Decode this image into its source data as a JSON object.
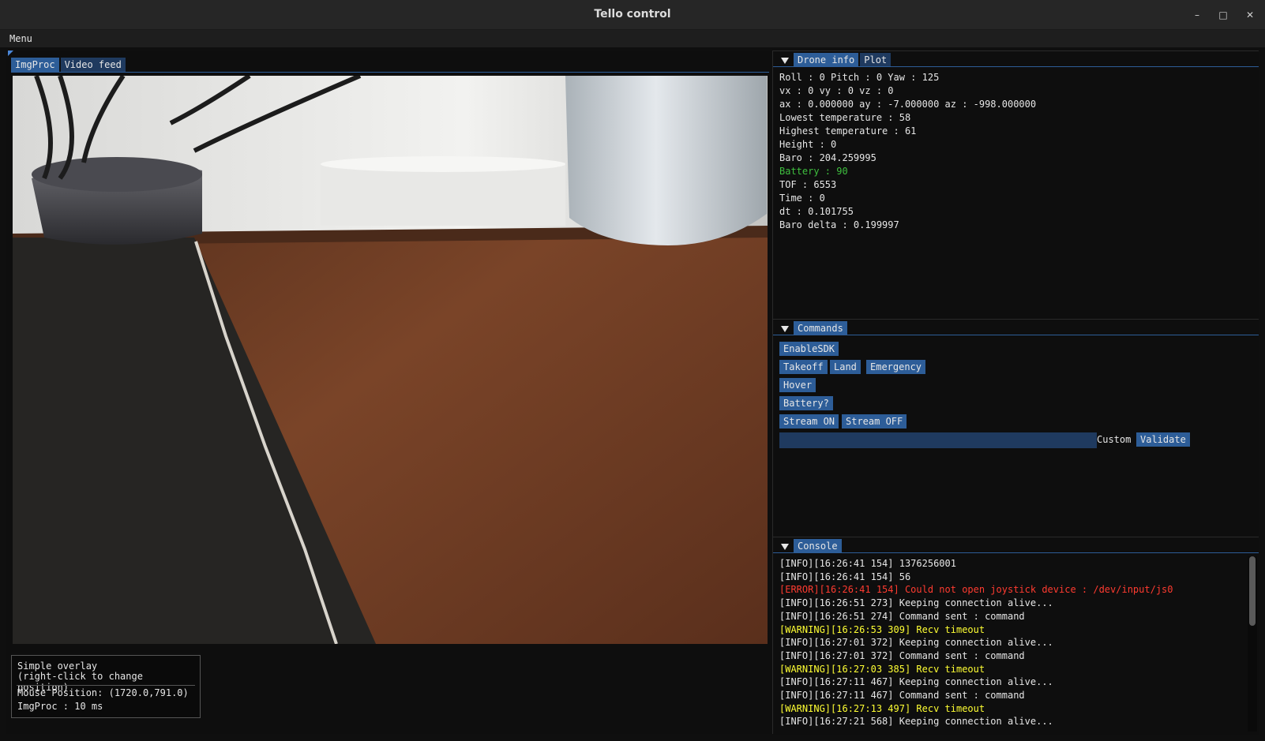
{
  "window": {
    "title": "Tello control",
    "minimize": "–",
    "maximize": "□",
    "close": "✕"
  },
  "menubar": {
    "menu": "Menu"
  },
  "left_tabs": [
    {
      "label": "ImgProc",
      "active": true
    },
    {
      "label": "Video feed",
      "active": false
    }
  ],
  "overlay": {
    "line1": "Simple overlay",
    "line2": "(right-click to change position)",
    "mouse": "Mouse Position: (1720.0,791.0)",
    "imgproc": "ImgProc :  10 ms"
  },
  "drone_panel": {
    "tabs": [
      {
        "label": "Drone info",
        "active": true
      },
      {
        "label": "Plot",
        "active": false
      }
    ],
    "lines": [
      "Roll : 0 Pitch : 0 Yaw : 125",
      "vx : 0 vy : 0 vz : 0",
      "ax : 0.000000 ay : -7.000000 az : -998.000000",
      "Lowest temperature : 58",
      "Highest temperature : 61",
      "Height : 0",
      "Baro : 204.259995",
      "Battery : 90",
      "TOF : 6553",
      "Time : 0",
      "dt : 0.101755",
      "Baro delta : 0.199997"
    ],
    "battery_color": "#3fbf3f"
  },
  "commands_panel": {
    "title": "Commands",
    "enable_sdk": "EnableSDK",
    "takeoff": "Takeoff",
    "land": "Land",
    "emergency": "Emergency",
    "hover": "Hover",
    "battery": "Battery?",
    "stream_on": "Stream ON",
    "stream_off": "Stream OFF",
    "custom_label": "Custom",
    "custom_value": "",
    "validate": "Validate"
  },
  "console_panel": {
    "title": "Console",
    "log": [
      {
        "level": "info",
        "text": "[INFO][16:26:41 154] 1376256001"
      },
      {
        "level": "info",
        "text": "[INFO][16:26:41 154] 56"
      },
      {
        "level": "error",
        "text": "[ERROR][16:26:41 154] Could not open joystick device : /dev/input/js0"
      },
      {
        "level": "info",
        "text": "[INFO][16:26:51 273] Keeping connection alive..."
      },
      {
        "level": "info",
        "text": "[INFO][16:26:51 274] Command sent : command"
      },
      {
        "level": "warning",
        "text": "[WARNING][16:26:53 309] Recv timeout"
      },
      {
        "level": "info",
        "text": "[INFO][16:27:01 372] Keeping connection alive..."
      },
      {
        "level": "info",
        "text": "[INFO][16:27:01 372] Command sent : command"
      },
      {
        "level": "warning",
        "text": "[WARNING][16:27:03 385] Recv timeout"
      },
      {
        "level": "info",
        "text": "[INFO][16:27:11 467] Keeping connection alive..."
      },
      {
        "level": "info",
        "text": "[INFO][16:27:11 467] Command sent : command"
      },
      {
        "level": "warning",
        "text": "[WARNING][16:27:13 497] Recv timeout"
      },
      {
        "level": "info",
        "text": "[INFO][16:27:21 568] Keeping connection alive..."
      }
    ],
    "colors": {
      "error": "#ff3b30",
      "warning": "#ffff33",
      "info": "#e6e6e6"
    }
  },
  "colors": {
    "accent": "#2d5d98",
    "tab_inactive": "#1f3a5f",
    "background": "#0e0e0e"
  }
}
